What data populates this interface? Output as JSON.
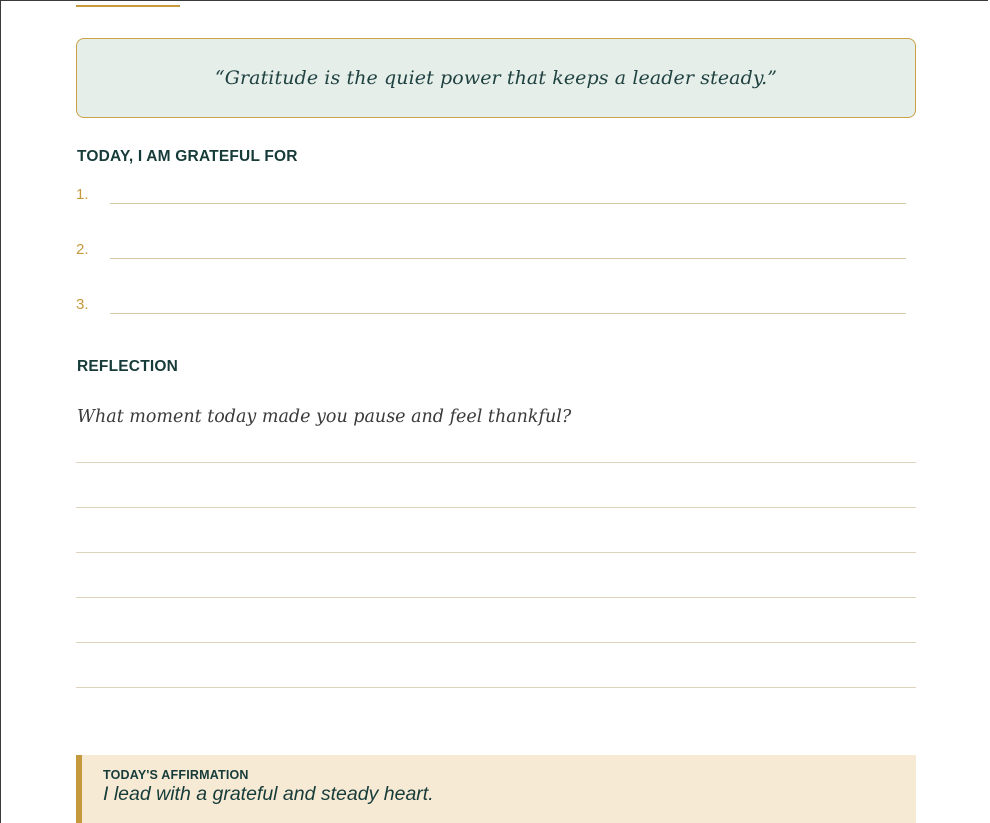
{
  "quote": {
    "text": "“Gratitude is the quiet power that keeps a leader steady.”"
  },
  "gratitude": {
    "heading": "TODAY, I AM GRATEFUL FOR",
    "items": [
      {
        "number": "1."
      },
      {
        "number": "2."
      },
      {
        "number": "3."
      }
    ]
  },
  "reflection": {
    "heading": "REFLECTION",
    "prompt": "What moment today made you pause and feel thankful?"
  },
  "affirmation": {
    "label": "TODAY'S AFFIRMATION",
    "text": "I lead with a grateful and steady heart."
  },
  "colors": {
    "accent_gold": "#c49a3c",
    "heading_teal": "#163b39",
    "quote_background": "#e6eeea",
    "affirmation_background": "#f6ead5"
  }
}
